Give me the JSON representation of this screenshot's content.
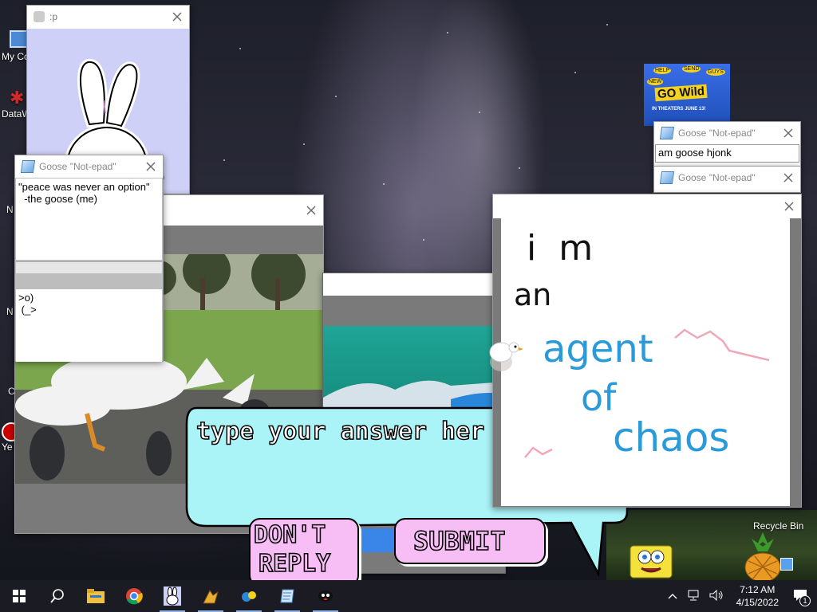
{
  "desktop": {
    "icons": [
      {
        "label": "My Co",
        "icon": "computer-icon"
      },
      {
        "label": "DataW",
        "icon": "datawatch-icon"
      },
      {
        "label": "N",
        "icon": "network-icon"
      },
      {
        "label": "Sp\nN",
        "icon": "app-icon"
      },
      {
        "label": "S\nC",
        "icon": "app-icon"
      },
      {
        "label": "Ye",
        "icon": "app-icon"
      },
      {
        "label": "Recycle Bin",
        "icon": "recycle-bin-icon"
      }
    ]
  },
  "bunny_window": {
    "title": ":p",
    "bg": "#cfd0f7"
  },
  "notepad_quote": {
    "title": "Goose \"Not-epad\"",
    "text": "\"peace was never an option\"\n  -the goose (me)",
    "text2": ">o)\n (_>"
  },
  "notepad_hjonk": {
    "title": "Goose \"Not-epad\"",
    "text": "am goose hjonk"
  },
  "notepad_third": {
    "title": "Goose \"Not-epad\""
  },
  "poster": {
    "lines": [
      "HELP",
      "SEND",
      "GUYS",
      "NEW",
      "GO Wild",
      "IN THEATERS JUNE 13!"
    ]
  },
  "drawing": {
    "lines": [
      "i  m",
      "an",
      "agent",
      "of",
      "chaos"
    ]
  },
  "dialog": {
    "prompt": "type your answer her",
    "dont_reply_lines": [
      "DON'T",
      "REPLY"
    ],
    "submit_label": "SUBMIT",
    "bubble_color": "#aaf3f7",
    "button_color": "#f7bdf5"
  },
  "taskbar": {
    "items": [
      {
        "icon": "windows-start-icon"
      },
      {
        "icon": "search-icon"
      },
      {
        "icon": "file-explorer-icon"
      },
      {
        "icon": "chrome-icon"
      },
      {
        "icon": "bunny-icon"
      },
      {
        "icon": "paint-icon"
      },
      {
        "icon": "app-icon"
      },
      {
        "icon": "notepad-icon"
      },
      {
        "icon": "goose-icon"
      }
    ],
    "time": "7:12 AM",
    "date": "4/15/2022",
    "notification_count": "1"
  }
}
